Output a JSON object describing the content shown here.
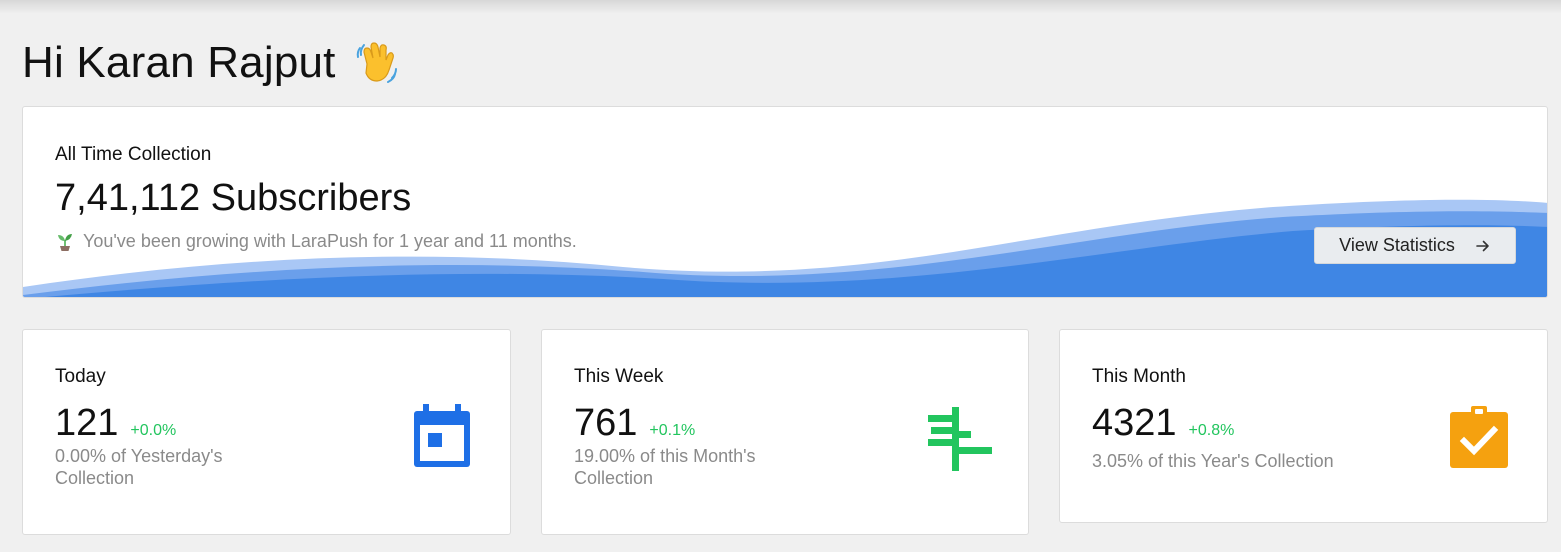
{
  "greeting": {
    "title": "Hi Karan Rajput",
    "emoji_icon": "waving-hand-icon"
  },
  "hero": {
    "label": "All Time Collection",
    "value": "7,41,112 Subscribers",
    "subtitle": "You've been growing with LaraPush for 1 year and 11 months.",
    "subtitle_icon": "seedling-icon",
    "button_label": "View Statistics",
    "button_icon": "arrow-right-icon",
    "wave_colors": [
      "#2f74e0",
      "#5b95ea",
      "#a9c7f5"
    ]
  },
  "cards": [
    {
      "label": "Today",
      "value": "121",
      "change": "+0.0%",
      "description_line1": "0.00% of Yesterday's",
      "description_line2": "Collection",
      "icon": "calendar-icon",
      "icon_color": "#1e6fe6"
    },
    {
      "label": "This Week",
      "value": "761",
      "change": "+0.1%",
      "description_line1": "19.00% of this Month's",
      "description_line2": "Collection",
      "icon": "timeline-icon",
      "icon_color": "#22c55e"
    },
    {
      "label": "This Month",
      "value": "4321",
      "change": "+0.8%",
      "description_line1": "3.05% of this Year's Collection",
      "icon": "clipboard-check-icon",
      "icon_color": "#f5a10f"
    }
  ],
  "colors": {
    "positive_change": "#22c55e",
    "muted_text": "#8a8a8a",
    "page_background": "#f0f0f0"
  }
}
